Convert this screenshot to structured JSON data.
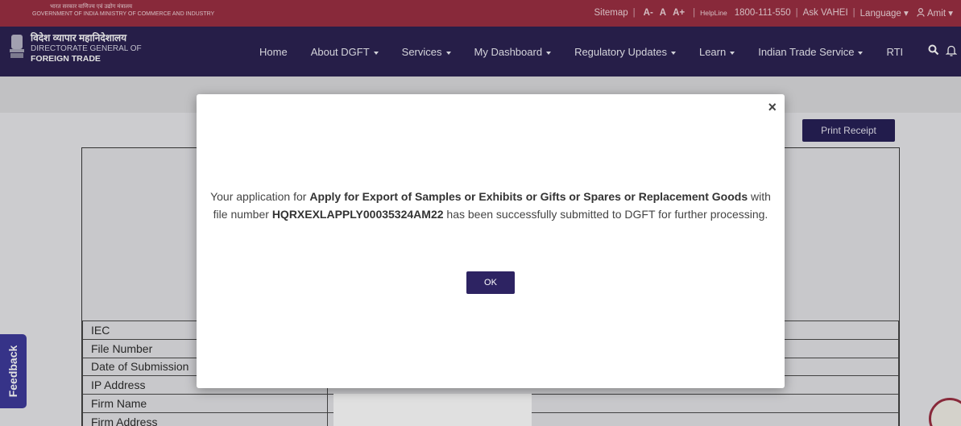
{
  "topbar": {
    "gov_hindi": "भारत सरकार   वाणिज्य एवं उद्योग मंत्रालय",
    "gov_english": "GOVERNMENT OF INDIA  MINISTRY OF COMMERCE AND INDUSTRY",
    "sitemap": "Sitemap",
    "font_decrease": "A-",
    "font_normal": "A",
    "font_increase": "A+",
    "helpline_label": "HelpLine",
    "helpline_number": "1800-111-550",
    "ask_vahei": "Ask VAHEI",
    "language": "Language",
    "user": "Amit"
  },
  "brand": {
    "hindi": "विदेश व्यापार महानिदेशालय",
    "line1": "DIRECTORATE GENERAL OF",
    "line2": "FOREIGN TRADE"
  },
  "nav": {
    "items": [
      {
        "label": "Home",
        "dropdown": false
      },
      {
        "label": "About DGFT",
        "dropdown": true
      },
      {
        "label": "Services",
        "dropdown": true
      },
      {
        "label": "My Dashboard",
        "dropdown": true
      },
      {
        "label": "Regulatory Updates",
        "dropdown": true
      },
      {
        "label": "Learn",
        "dropdown": true
      },
      {
        "label": "Indian Trade Service",
        "dropdown": true
      },
      {
        "label": "RTI",
        "dropdown": false
      }
    ]
  },
  "page": {
    "print_receipt": "Print Receipt",
    "receipt_rows": [
      "IEC",
      "File Number",
      "Date of Submission",
      "IP Address",
      "Firm Name",
      "Firm Address"
    ],
    "feedback": "Feedback"
  },
  "modal": {
    "close": "×",
    "text_1": "Your application for ",
    "application_name": "Apply for Export of Samples or Exhibits or Gifts or Spares or Replacement Goods",
    "text_2": " with file number ",
    "file_number": "HQRXEXLAPPLY00035324AM22",
    "text_3": " has been successfully submitted to DGFT for further processing.",
    "ok": "OK"
  },
  "colors": {
    "topbar": "#9b2f43",
    "navbar": "#2c2353",
    "button": "#2d2362"
  }
}
